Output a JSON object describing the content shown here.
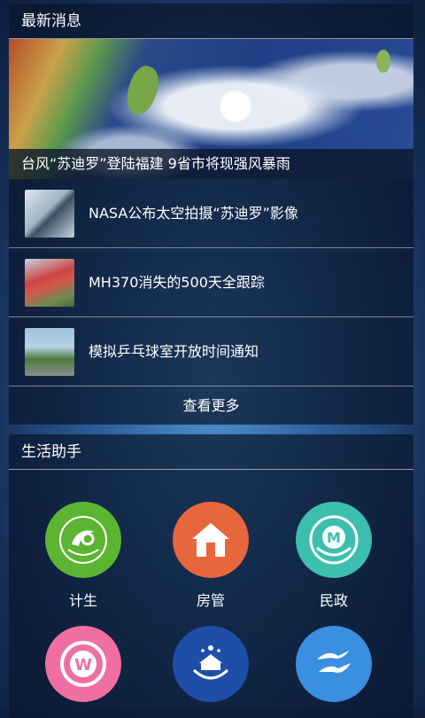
{
  "news": {
    "header": "最新消息",
    "hero_caption": "台风“苏迪罗”登陆福建 9省市将现强风暴雨",
    "items": [
      {
        "title": "NASA公布太空拍摄“苏迪罗”影像"
      },
      {
        "title": "MH370消失的500天全跟踪"
      },
      {
        "title": "模拟乒乓球室开放时间通知"
      }
    ],
    "more_label": "查看更多"
  },
  "life": {
    "header": "生活助手",
    "services": [
      {
        "label": "计生",
        "color": "#5cb531",
        "icon": "family-planning-icon"
      },
      {
        "label": "房管",
        "color": "#e8663c",
        "icon": "house-icon"
      },
      {
        "label": "民政",
        "color": "#3cbfae",
        "icon": "civil-affairs-emblem-icon"
      },
      {
        "label": "",
        "color": "#ef6fa0",
        "icon": "w-coin-icon"
      },
      {
        "label": "",
        "color": "#1e4fa8",
        "icon": "national-emblem-icon"
      },
      {
        "label": "",
        "color": "#3a8fe0",
        "icon": "wave-logo-icon"
      }
    ]
  }
}
